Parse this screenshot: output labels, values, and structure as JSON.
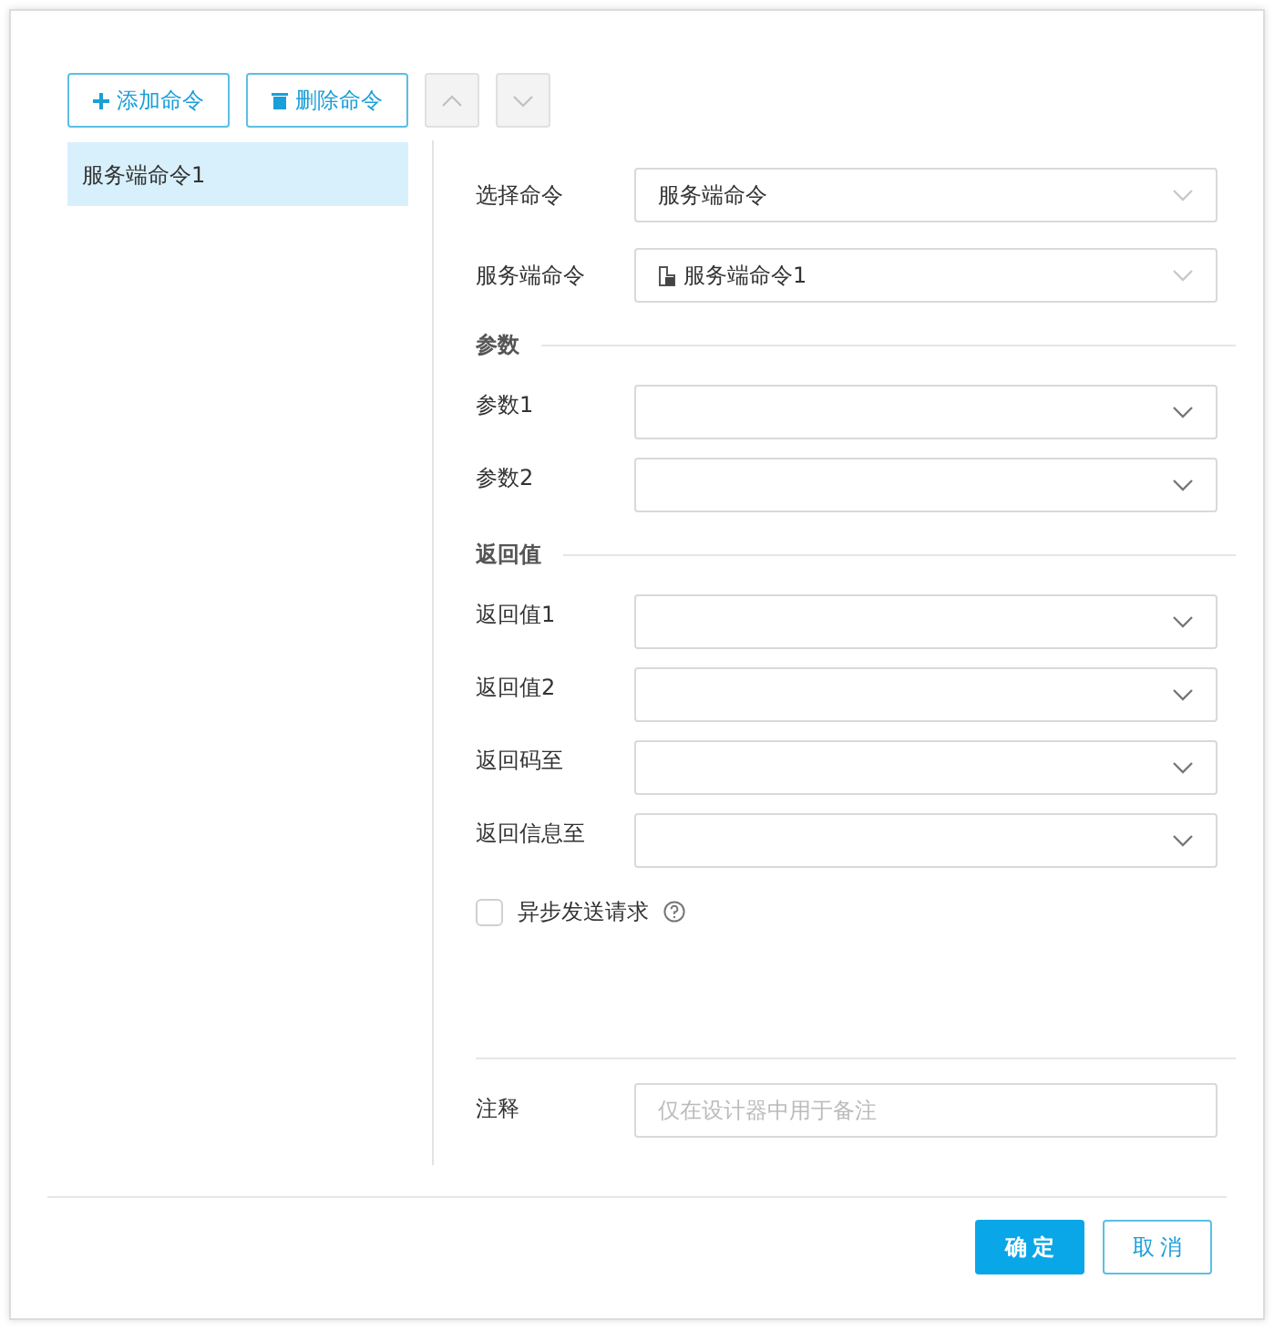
{
  "toolbar": [
    {
      "kind": "add",
      "label": "添加命令"
    },
    {
      "kind": "delete",
      "label": "删除命令"
    },
    {
      "kind": "up",
      "disabled": true
    },
    {
      "kind": "down",
      "disabled": true
    }
  ],
  "command_list": [
    {
      "label": "服务端命令1",
      "selected": true
    }
  ],
  "command_fields": [
    {
      "label": "选择命令",
      "value": "服务端命令"
    },
    {
      "label": "服务端命令",
      "value": "服务端命令1",
      "icon": true
    }
  ],
  "sections": [
    {
      "title": "参数",
      "fields": [
        {
          "label": "参数1"
        },
        {
          "label": "参数2"
        }
      ]
    },
    {
      "title": "返回值",
      "fields": [
        {
          "label": "返回值1"
        },
        {
          "label": "返回值2"
        },
        {
          "label": "返回码至"
        },
        {
          "label": "返回信息至"
        }
      ]
    }
  ],
  "async_request": {
    "label": "异步发送请求",
    "checked": false
  },
  "comment": {
    "label": "注释",
    "placeholder": "仅在设计器中用于备注"
  },
  "buttons": [
    {
      "kind": "primary",
      "label": "确定"
    },
    {
      "kind": "secondary",
      "label": "取消"
    }
  ]
}
